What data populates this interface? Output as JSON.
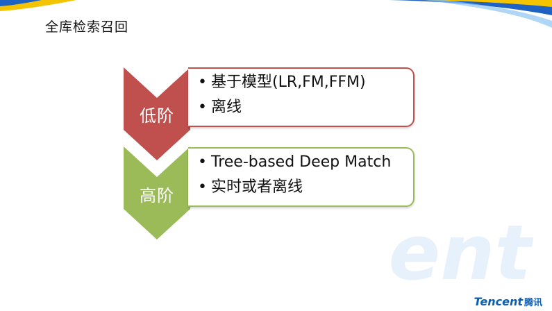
{
  "slide": {
    "title": "全库检索召回"
  },
  "tiers": [
    {
      "label": "低阶",
      "color": "#c0504d",
      "border_color": "#c0504d",
      "items": [
        "基于模型(LR,FM,FFM)",
        "离线"
      ]
    },
    {
      "label": "高阶",
      "color": "#9bbb59",
      "border_color": "#9bbb59",
      "items": [
        "Tree-based Deep Match",
        "实时或者离线"
      ]
    }
  ],
  "brand": {
    "name_en": "Tencent",
    "name_zh": "腾讯",
    "watermark": "ent",
    "accent_blue": "#0a5fb4",
    "accent_yellow": "#f5c400"
  }
}
